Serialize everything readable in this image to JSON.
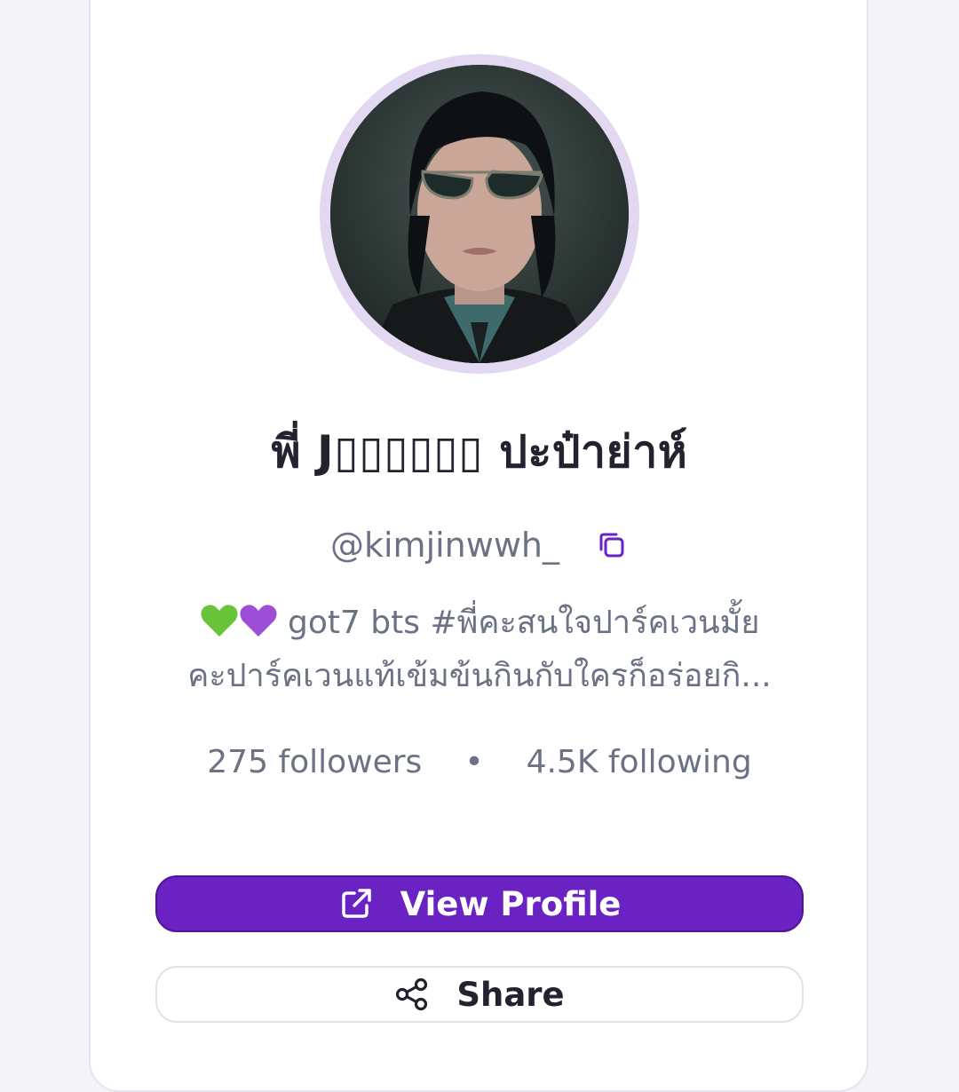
{
  "profile": {
    "display_name": "พี่ J▯▯▯▯▯▯ ปะป๋าย่าห์",
    "handle": "@kimjinwwh_",
    "bio_line1_text": "got7 bts #พี่คะสนใจปาร์คเวนมั้ย",
    "bio_line2": "คะปาร์คเวนแท้เข้มข้นกินกับใครก็อร่อยกิ...",
    "bio_emojis": [
      "green-heart-icon",
      "purple-heart-icon"
    ],
    "followers": "275 followers",
    "separator": "•",
    "following": "4.5K following"
  },
  "actions": {
    "view_profile_label": "View Profile",
    "share_label": "Share"
  },
  "colors": {
    "primary": "#6a22c3",
    "text_dark": "#23232f",
    "text_muted": "#6b7284",
    "avatar_ring": "#e3d8f2",
    "green_heart": "#6ac43a",
    "purple_heart": "#9b4fd6"
  },
  "icons": {
    "copy": "copy-icon",
    "external_link": "external-link-icon",
    "share": "share-icon"
  }
}
